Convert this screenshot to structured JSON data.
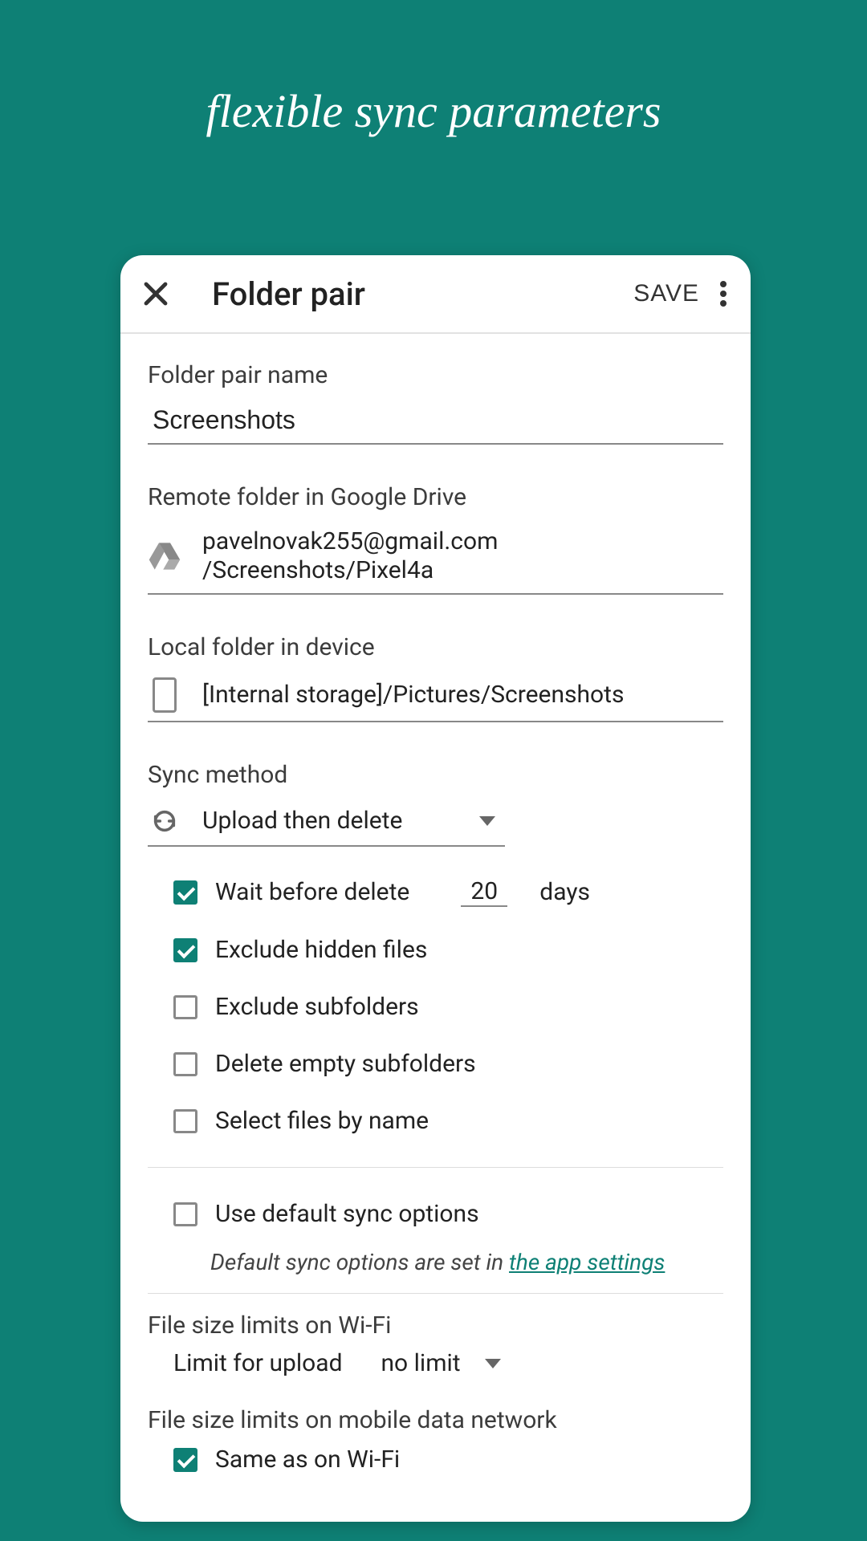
{
  "banner": {
    "title": "flexible sync parameters"
  },
  "toolbar": {
    "title": "Folder pair",
    "save_label": "SAVE"
  },
  "folder_pair_name": {
    "label": "Folder pair name",
    "value": "Screenshots"
  },
  "remote_folder": {
    "label": "Remote folder in Google Drive",
    "account": "pavelnovak255@gmail.com",
    "path": "/Screenshots/Pixel4a"
  },
  "local_folder": {
    "label": "Local folder in device",
    "path": "[Internal storage]/Pictures/Screenshots"
  },
  "sync_method": {
    "label": "Sync method",
    "selected": "Upload then delete"
  },
  "options": {
    "wait_before_delete": {
      "label": "Wait before delete",
      "checked": true,
      "value": "20",
      "unit": "days"
    },
    "exclude_hidden": {
      "label": "Exclude hidden files",
      "checked": true
    },
    "exclude_subfolders": {
      "label": "Exclude subfolders",
      "checked": false
    },
    "delete_empty_subfolders": {
      "label": "Delete empty subfolders",
      "checked": false
    },
    "select_files_by_name": {
      "label": "Select files by name",
      "checked": false
    },
    "use_default_sync": {
      "label": "Use default sync options",
      "checked": false
    },
    "hint_prefix": "Default sync options are set in ",
    "hint_link": "the app settings"
  },
  "wifi_limits": {
    "label": "File size limits on Wi-Fi",
    "sub_label": "Limit for upload",
    "value": "no limit"
  },
  "mobile_limits": {
    "label": "File size limits on mobile data network",
    "same_as_wifi": {
      "label": "Same as on Wi-Fi",
      "checked": true
    }
  }
}
